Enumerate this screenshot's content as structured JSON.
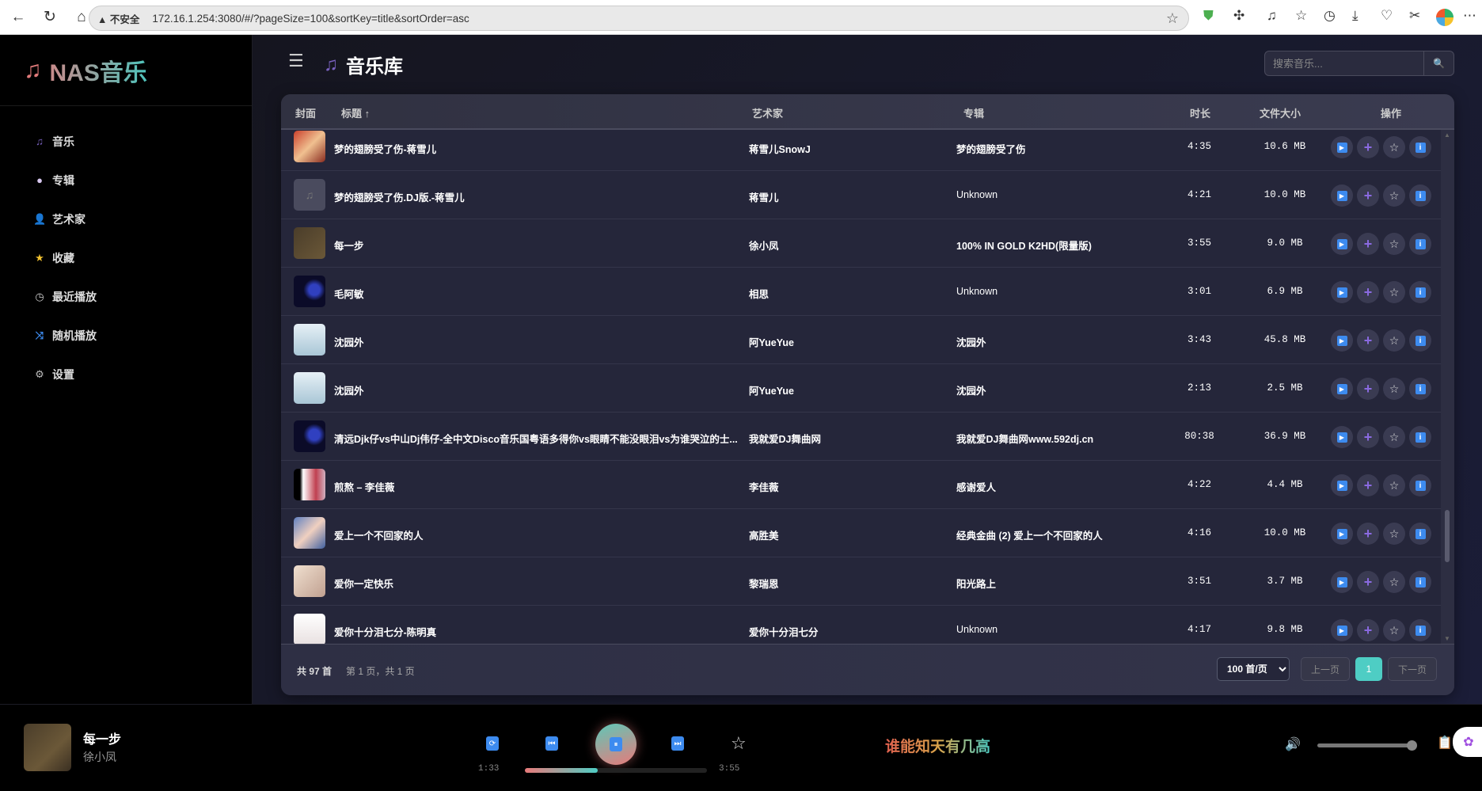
{
  "browser": {
    "security_label": "不安全",
    "url": "172.16.1.254:3080/#/?pageSize=100&sortKey=title&sortOrder=asc"
  },
  "app": {
    "logo_icon": "music-note",
    "name": "NAS音乐"
  },
  "sidebar": {
    "items": [
      {
        "label": "音乐",
        "icon": "music-note",
        "color": "#7a62c0"
      },
      {
        "label": "专辑",
        "icon": "disc",
        "color": "#d8c8f0"
      },
      {
        "label": "艺术家",
        "icon": "person",
        "color": "#5a3d9a"
      },
      {
        "label": "收藏",
        "icon": "star",
        "color": "#f2c230"
      },
      {
        "label": "最近播放",
        "icon": "clock",
        "color": "#ccc"
      },
      {
        "label": "随机播放",
        "icon": "shuffle",
        "color": "#3d8bef"
      },
      {
        "label": "设置",
        "icon": "gear",
        "color": "#bbb"
      }
    ]
  },
  "header": {
    "title": "音乐库",
    "search_placeholder": "搜索音乐...",
    "search_icon": "magnifier"
  },
  "table": {
    "columns": {
      "cover": "封面",
      "title": "标题 ↑",
      "artist": "艺术家",
      "album": "专辑",
      "duration": "时长",
      "size": "文件大小",
      "actions": "操作"
    },
    "rows": [
      {
        "title": "梦的翅膀受了伤-蒋雪儿",
        "artist": "蒋雪儿SnowJ",
        "album": "梦的翅膀受了伤",
        "duration": "4:35",
        "size": "10.6 MB"
      },
      {
        "title": "梦的翅膀受了伤.DJ版.-蒋雪儿",
        "artist": "蒋雪儿",
        "album": "Unknown",
        "duration": "4:21",
        "size": "10.0 MB"
      },
      {
        "title": "每一步",
        "artist": "徐小凤",
        "album": "100% IN GOLD K2HD(限量版)",
        "duration": "3:55",
        "size": "9.0 MB"
      },
      {
        "title": "毛阿敏",
        "artist": "相思",
        "album": "Unknown",
        "duration": "3:01",
        "size": "6.9 MB"
      },
      {
        "title": "沈园外",
        "artist": "阿YueYue",
        "album": "沈园外",
        "duration": "3:43",
        "size": "45.8 MB"
      },
      {
        "title": "沈园外",
        "artist": "阿YueYue",
        "album": "沈园外",
        "duration": "2:13",
        "size": "2.5 MB"
      },
      {
        "title": "清远Djk仔vs中山Dj伟仔-全中文Disco音乐国粤语多得你vs眼睛不能没眼泪vs为谁哭泣的士...",
        "artist": "我就爱DJ舞曲网",
        "album": "我就爱DJ舞曲网www.592dj.cn",
        "duration": "80:38",
        "size": "36.9 MB"
      },
      {
        "title": "煎熬 – 李佳薇",
        "artist": "李佳薇",
        "album": "感谢爱人",
        "duration": "4:22",
        "size": "4.4 MB"
      },
      {
        "title": "爱上一个不回家的人",
        "artist": "高胜美",
        "album": "经典金曲 (2) 爱上一个不回家的人",
        "duration": "4:16",
        "size": "10.0 MB"
      },
      {
        "title": "爱你一定快乐",
        "artist": "黎瑞恩",
        "album": "阳光路上",
        "duration": "3:51",
        "size": "3.7 MB"
      },
      {
        "title": "爱你十分泪七分-陈明真",
        "artist": "爱你十分泪七分",
        "album": "Unknown",
        "duration": "4:17",
        "size": "9.8 MB"
      }
    ],
    "action_icons": [
      "play",
      "add",
      "star",
      "info"
    ]
  },
  "pagination": {
    "total": "共 97 首",
    "page_info": "第 1 页，共 1 页",
    "page_size": "100 首/页",
    "prev": "上一页",
    "current": "1",
    "next": "下一页"
  },
  "player": {
    "title": "每一步",
    "artist": "徐小凤",
    "current_time": "1:33",
    "total_time": "3:55",
    "progress_percent": 40,
    "lyric": "谁能知天有几高",
    "volume_percent": 100,
    "controls": {
      "repeat": "⟳",
      "prev": "⏮",
      "pause": "⏸",
      "next": "⏭",
      "favorite": "☆"
    }
  },
  "colors": {
    "accent": "#4ecdc4",
    "coral": "#e87a7a",
    "button_blue": "#3d8bef",
    "purple": "#7a62c0"
  }
}
